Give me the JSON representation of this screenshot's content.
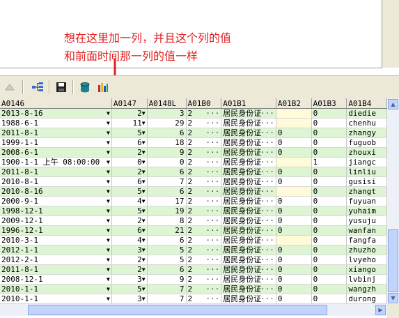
{
  "annotation": {
    "line1": "想在这里加一列，并且这个列的值",
    "line2": "和前面时间那一列的值一样"
  },
  "toolbar": {
    "icons": [
      "up-arrow-icon",
      "tree-icon",
      "save-icon",
      "database-icon",
      "chart-icon"
    ]
  },
  "colors": {
    "green_row": "#ddf5d3",
    "annotation": "#e02020"
  },
  "table": {
    "headers": [
      "A0146",
      "A0147",
      "A0148L",
      "A01B0",
      "A01B1",
      "A01B2",
      "A01B3",
      "A01B4"
    ],
    "rows": [
      [
        "2013-8-16",
        "2",
        "3",
        "2",
        "居民身份证",
        "",
        "0",
        "diedie"
      ],
      [
        "1988-6-1",
        "11",
        "29",
        "2",
        "居民身份证",
        "",
        "0",
        "chenhu"
      ],
      [
        "2011-8-1",
        "5",
        "6",
        "2",
        "居民身份证",
        "0",
        "0",
        "zhangy"
      ],
      [
        "1999-1-1",
        "6",
        "18",
        "2",
        "居民身份证",
        "0",
        "0",
        "fuguob"
      ],
      [
        "2008-6-1",
        "2",
        "9",
        "2",
        "居民身份证",
        "0",
        "0",
        "zhouxi"
      ],
      [
        "1900-1-1 上午 08:00:00",
        "0",
        "0",
        "2",
        "居民身份证",
        "",
        "1",
        "jiangc"
      ],
      [
        "2011-8-1",
        "2",
        "6",
        "2",
        "居民身份证",
        "0",
        "0",
        "linliu"
      ],
      [
        "2010-8-1",
        "6",
        "7",
        "2",
        "居民身份证",
        "0",
        "0",
        "gusisi"
      ],
      [
        "2010-8-16",
        "5",
        "6",
        "2",
        "居民身份证",
        "",
        "0",
        "zhangt"
      ],
      [
        "2000-9-1",
        "4",
        "17",
        "2",
        "居民身份证",
        "0",
        "0",
        "fuyuan"
      ],
      [
        "1998-12-1",
        "5",
        "19",
        "2",
        "居民身份证",
        "0",
        "0",
        "yuhaim"
      ],
      [
        "2009-12-1",
        "2",
        "8",
        "2",
        "居民身份证",
        "0",
        "0",
        "yusuju"
      ],
      [
        "1996-12-1",
        "6",
        "21",
        "2",
        "居民身份证",
        "0",
        "0",
        "wanfan"
      ],
      [
        "2010-3-1",
        "4",
        "6",
        "2",
        "居民身份证",
        "",
        "0",
        "fangfa"
      ],
      [
        "2012-1-1",
        "3",
        "5",
        "2",
        "居民身份证",
        "0",
        "0",
        "zhuzho"
      ],
      [
        "2012-2-1",
        "2",
        "5",
        "2",
        "居民身份证",
        "0",
        "0",
        "lvyeho"
      ],
      [
        "2011-8-1",
        "2",
        "6",
        "2",
        "居民身份证",
        "0",
        "0",
        "xiango"
      ],
      [
        "2008-12-1",
        "3",
        "9",
        "2",
        "居民身份证",
        "0",
        "0",
        "lvbinj"
      ],
      [
        "2010-1-1",
        "5",
        "7",
        "2",
        "居民身份证",
        "0",
        "0",
        "wangzh"
      ],
      [
        "2010-1-1",
        "3",
        "7",
        "2",
        "居民身份证",
        "0",
        "0",
        "durong"
      ]
    ]
  }
}
